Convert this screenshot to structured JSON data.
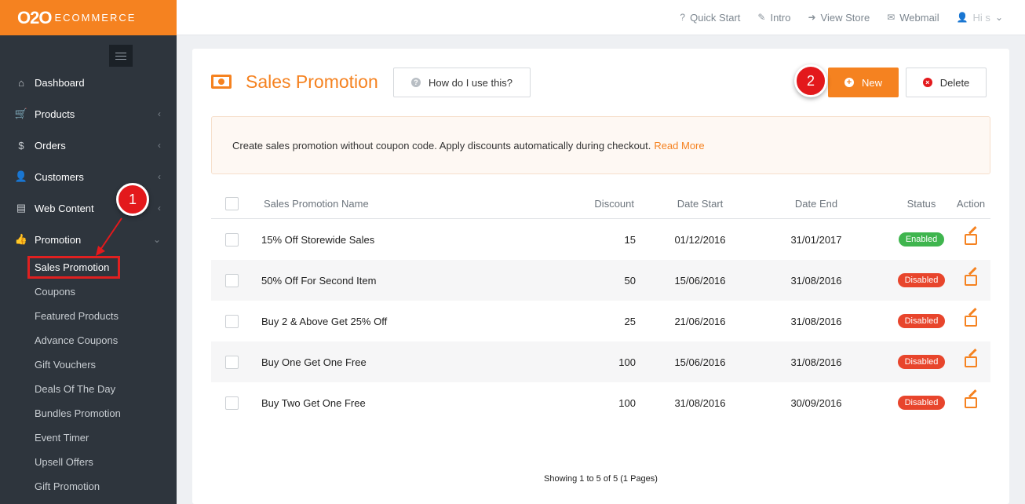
{
  "brand": {
    "main": "O2O",
    "sub": "ECOMMERCE",
    "color": "#f58220"
  },
  "topbar": {
    "links": [
      {
        "icon": "question-icon",
        "label": "Quick Start"
      },
      {
        "icon": "wand-icon",
        "label": "Intro"
      },
      {
        "icon": "sign-in-icon",
        "label": "View Store"
      },
      {
        "icon": "envelope-icon",
        "label": "Webmail"
      },
      {
        "icon": "user-icon",
        "label": "Hi s"
      }
    ]
  },
  "sidebar": {
    "items": [
      {
        "icon": "home-icon",
        "label": "Dashboard"
      },
      {
        "icon": "cart-icon",
        "label": "Products"
      },
      {
        "icon": "dollar-icon",
        "label": "Orders"
      },
      {
        "icon": "user-icon",
        "label": "Customers"
      },
      {
        "icon": "book-icon",
        "label": "Web Content"
      },
      {
        "icon": "thumbs-up-icon",
        "label": "Promotion"
      }
    ],
    "submenu": [
      "Sales Promotion",
      "Coupons",
      "Featured Products",
      "Advance Coupons",
      "Gift Vouchers",
      "Deals Of The Day",
      "Bundles Promotion",
      "Event Timer",
      "Upsell Offers",
      "Gift Promotion"
    ]
  },
  "markers": {
    "one": "1",
    "two": "2"
  },
  "page": {
    "title": "Sales Promotion",
    "help_label": "How do I use this?",
    "new_label": "New",
    "delete_label": "Delete",
    "notice_text": "Create sales promotion without coupon code. Apply discounts automatically during checkout.",
    "notice_link": "Read More"
  },
  "table": {
    "headers": {
      "name": "Sales Promotion Name",
      "discount": "Discount",
      "start": "Date Start",
      "end": "Date End",
      "status": "Status",
      "action": "Action"
    },
    "rows": [
      {
        "name": "15% Off Storewide Sales",
        "discount": "15",
        "start": "01/12/2016",
        "end": "31/01/2017",
        "status": "Enabled"
      },
      {
        "name": "50% Off For Second Item",
        "discount": "50",
        "start": "15/06/2016",
        "end": "31/08/2016",
        "status": "Disabled"
      },
      {
        "name": "Buy 2 & Above Get 25% Off",
        "discount": "25",
        "start": "21/06/2016",
        "end": "31/08/2016",
        "status": "Disabled"
      },
      {
        "name": "Buy One Get One Free",
        "discount": "100",
        "start": "15/06/2016",
        "end": "31/08/2016",
        "status": "Disabled"
      },
      {
        "name": "Buy Two Get One Free",
        "discount": "100",
        "start": "31/08/2016",
        "end": "30/09/2016",
        "status": "Disabled"
      }
    ],
    "status_colors": {
      "Enabled": "#3fb54e",
      "Disabled": "#e8452c"
    }
  },
  "pagination": {
    "text": "Showing 1 to 5 of 5 (1 Pages)"
  }
}
